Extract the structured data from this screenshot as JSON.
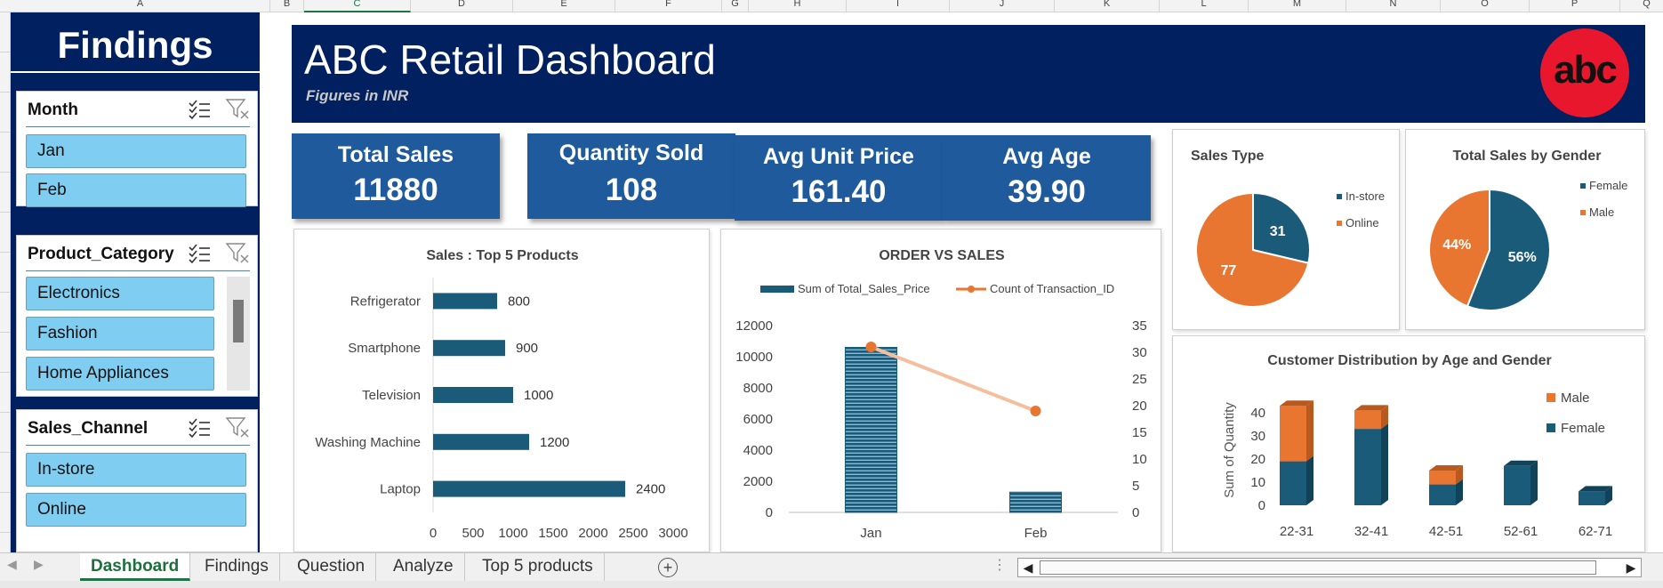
{
  "columns": [
    "A",
    "B",
    "C",
    "D",
    "E",
    "F",
    "G",
    "H",
    "I",
    "J",
    "K",
    "L",
    "M",
    "N",
    "O",
    "P",
    "Q"
  ],
  "findings": {
    "title": "Findings",
    "slicers": [
      {
        "title": "Month",
        "items": [
          "Jan",
          "Feb"
        ]
      },
      {
        "title": "Product_Category",
        "items": [
          "Electronics",
          "Fashion",
          "Home Appliances"
        ]
      },
      {
        "title": "Sales_Channel",
        "items": [
          "In-store",
          "Online"
        ]
      }
    ]
  },
  "banner": {
    "title": "ABC Retail Dashboard",
    "subtitle": "Figures in INR",
    "logo_text": "abc"
  },
  "kpis": [
    {
      "label": "Total Sales",
      "value": "11880"
    },
    {
      "label": "Quantity Sold",
      "value": "108"
    },
    {
      "label": "Avg Unit Price",
      "value": "161.40"
    },
    {
      "label": "Avg Age",
      "value": "39.90"
    }
  ],
  "colors": {
    "navy": "#002060",
    "kpi_blue": "#1f5b9c",
    "teal": "#1a5b7a",
    "orange": "#e87530",
    "slicer_item": "#7fcdf0",
    "excel_green": "#217346"
  },
  "chart_data": [
    {
      "type": "bar",
      "title": "Sales : Top 5 Products",
      "orientation": "horizontal",
      "categories": [
        "Refrigerator",
        "Smartphone",
        "Television",
        "Washing Machine",
        "Laptop"
      ],
      "values": [
        800,
        900,
        1000,
        1200,
        2400
      ],
      "xlim": [
        0,
        3000
      ],
      "xticks": [
        0,
        500,
        1000,
        1500,
        2000,
        2500,
        3000
      ],
      "color": "#1a5b7a"
    },
    {
      "type": "bar",
      "title": "ORDER VS SALES",
      "categories": [
        "Jan",
        "Feb"
      ],
      "series": [
        {
          "name": "Sum of Total_Sales_Price",
          "type": "bar",
          "axis": "left",
          "values": [
            10600,
            1300
          ]
        },
        {
          "name": "Count of Transaction_ID",
          "type": "line",
          "axis": "right",
          "values": [
            31,
            19
          ]
        }
      ],
      "ylim": [
        0,
        12000
      ],
      "yticks": [
        0,
        2000,
        4000,
        6000,
        8000,
        10000,
        12000
      ],
      "y2lim": [
        0,
        35
      ],
      "y2ticks": [
        0,
        5,
        10,
        15,
        20,
        25,
        30,
        35
      ],
      "legend": "top"
    },
    {
      "type": "pie",
      "title": "Sales Type",
      "labels": [
        "In-store",
        "Online"
      ],
      "values": [
        31,
        77
      ],
      "data_labels": [
        "31",
        "77"
      ],
      "colors": [
        "#1a5b7a",
        "#e87530"
      ],
      "legend": "right"
    },
    {
      "type": "pie",
      "title": "Total Sales by Gender",
      "labels": [
        "Female",
        "Male"
      ],
      "values": [
        56,
        44
      ],
      "data_labels": [
        "56%",
        "44%"
      ],
      "colors": [
        "#1a5b7a",
        "#e87530"
      ],
      "legend": "right"
    },
    {
      "type": "bar",
      "stacked": true,
      "title": "Customer Distribution by Age and Gender",
      "categories": [
        "22-31",
        "32-41",
        "42-51",
        "52-61",
        "62-71"
      ],
      "series": [
        {
          "name": "Female",
          "values": [
            19,
            33,
            9,
            17,
            6
          ]
        },
        {
          "name": "Male",
          "values": [
            24,
            8,
            6,
            0,
            0
          ]
        }
      ],
      "ylabel": "Sum of Quantity",
      "ylim": [
        0,
        40
      ],
      "yticks": [
        0,
        10,
        20,
        30,
        40
      ],
      "legend": "right"
    }
  ],
  "sheet_tabs": [
    "Dashboard",
    "Findings",
    "Question",
    "Analyze",
    "Top 5 products"
  ],
  "active_tab": "Dashboard"
}
